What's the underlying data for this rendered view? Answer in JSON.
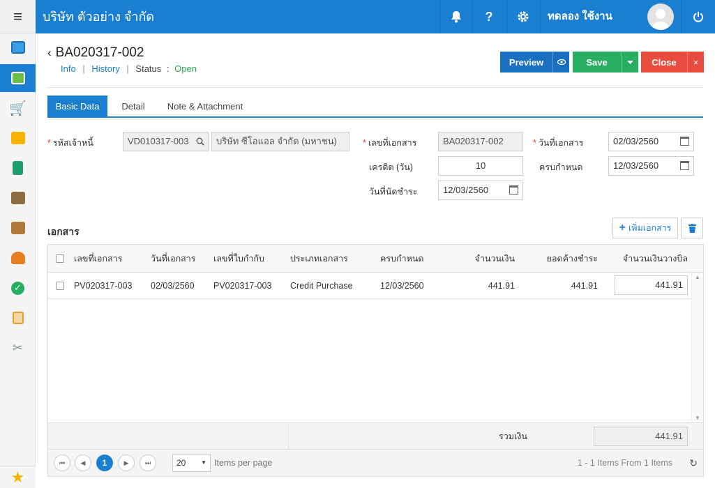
{
  "app": {
    "company": "บริษัท ตัวอย่าง จำกัด",
    "user": "ทดลอง ใช้งาน",
    "help_label": "?"
  },
  "doc": {
    "title": "BA020317-002",
    "info_link": "Info",
    "history_link": "History",
    "status_label": "Status",
    "status_sep": ":",
    "status_value": "Open"
  },
  "actions": {
    "preview": "Preview",
    "save": "Save",
    "close": "Close"
  },
  "tabs": [
    "Basic Data",
    "Detail",
    "Note & Attachment"
  ],
  "form": {
    "creditor_label": "รหัสเจ้าหนี้",
    "creditor_code": "VD010317-003",
    "creditor_name": "บริษัท ซีโอแอล จำกัด (มหาชน)",
    "doc_no_label": "เลขที่เอกสาร",
    "doc_no": "BA020317-002",
    "doc_date_label": "วันที่เอกสาร",
    "doc_date": "02/03/2560",
    "credit_days_label": "เครดิต (วัน)",
    "credit_days": "10",
    "due_label": "ครบกำหนด",
    "due_date": "12/03/2560",
    "pay_date_label": "วันที่นัดชำระ",
    "pay_date": "12/03/2560"
  },
  "documents": {
    "title": "เอกสาร",
    "add_label": "เพิ่มเอกสาร",
    "columns": [
      "เลขที่เอกสาร",
      "วันที่เอกสาร",
      "เลขที่ใบกำกับ",
      "ประเภทเอกสาร",
      "ครบกำหนด",
      "จำนวนเงิน",
      "ยอดค้างชำระ",
      "จำนวนเงินวางบิล"
    ],
    "rows": [
      {
        "doc_no": "PV020317-003",
        "doc_date": "02/03/2560",
        "invoice_no": "PV020317-003",
        "doc_type": "Credit Purchase",
        "due": "12/03/2560",
        "amount": "441.91",
        "outstanding": "441.91",
        "billing_amount": "441.91"
      }
    ],
    "total_label": "รวมเงิน",
    "total": "441.91"
  },
  "pager": {
    "current_page": "1",
    "page_size": "20",
    "items_per_page": "Items per page",
    "summary": "1 - 1 Items From 1 Items"
  },
  "colors": {
    "primary": "#1b7fd1",
    "save": "#27ae60",
    "close": "#e74c3c",
    "status_open": "#2aa64a"
  }
}
